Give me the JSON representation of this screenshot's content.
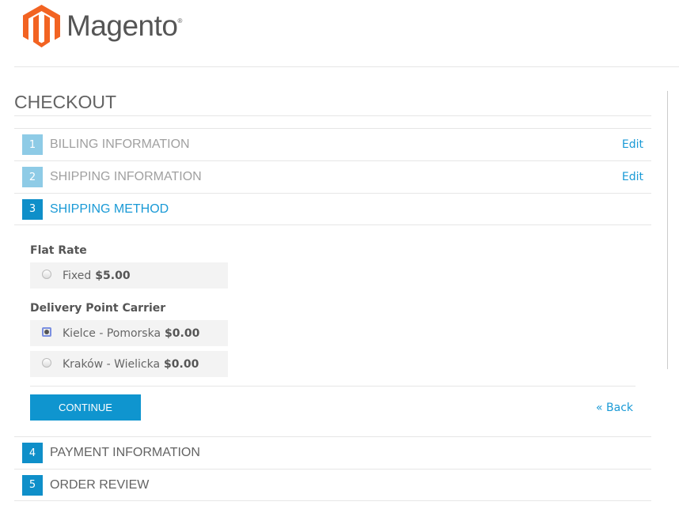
{
  "logo": {
    "text": "Magento",
    "mark": "®"
  },
  "page": {
    "title": "CHECKOUT"
  },
  "steps": [
    {
      "num": "1",
      "label": "BILLING INFORMATION",
      "edit": "Edit"
    },
    {
      "num": "2",
      "label": "SHIPPING INFORMATION",
      "edit": "Edit"
    },
    {
      "num": "3",
      "label": "SHIPPING METHOD"
    },
    {
      "num": "4",
      "label": "PAYMENT INFORMATION"
    },
    {
      "num": "5",
      "label": "ORDER REVIEW"
    }
  ],
  "shipping": {
    "groups": [
      {
        "title": "Flat Rate",
        "options": [
          {
            "label": "Fixed",
            "price": "$5.00",
            "selected": false
          }
        ]
      },
      {
        "title": "Delivery Point Carrier",
        "options": [
          {
            "label": "Kielce - Pomorska",
            "price": "$0.00",
            "selected": true
          },
          {
            "label": "Kraków - Wielicka",
            "price": "$0.00",
            "selected": false
          }
        ]
      }
    ],
    "continue": "CONTINUE",
    "back": "« Back"
  }
}
